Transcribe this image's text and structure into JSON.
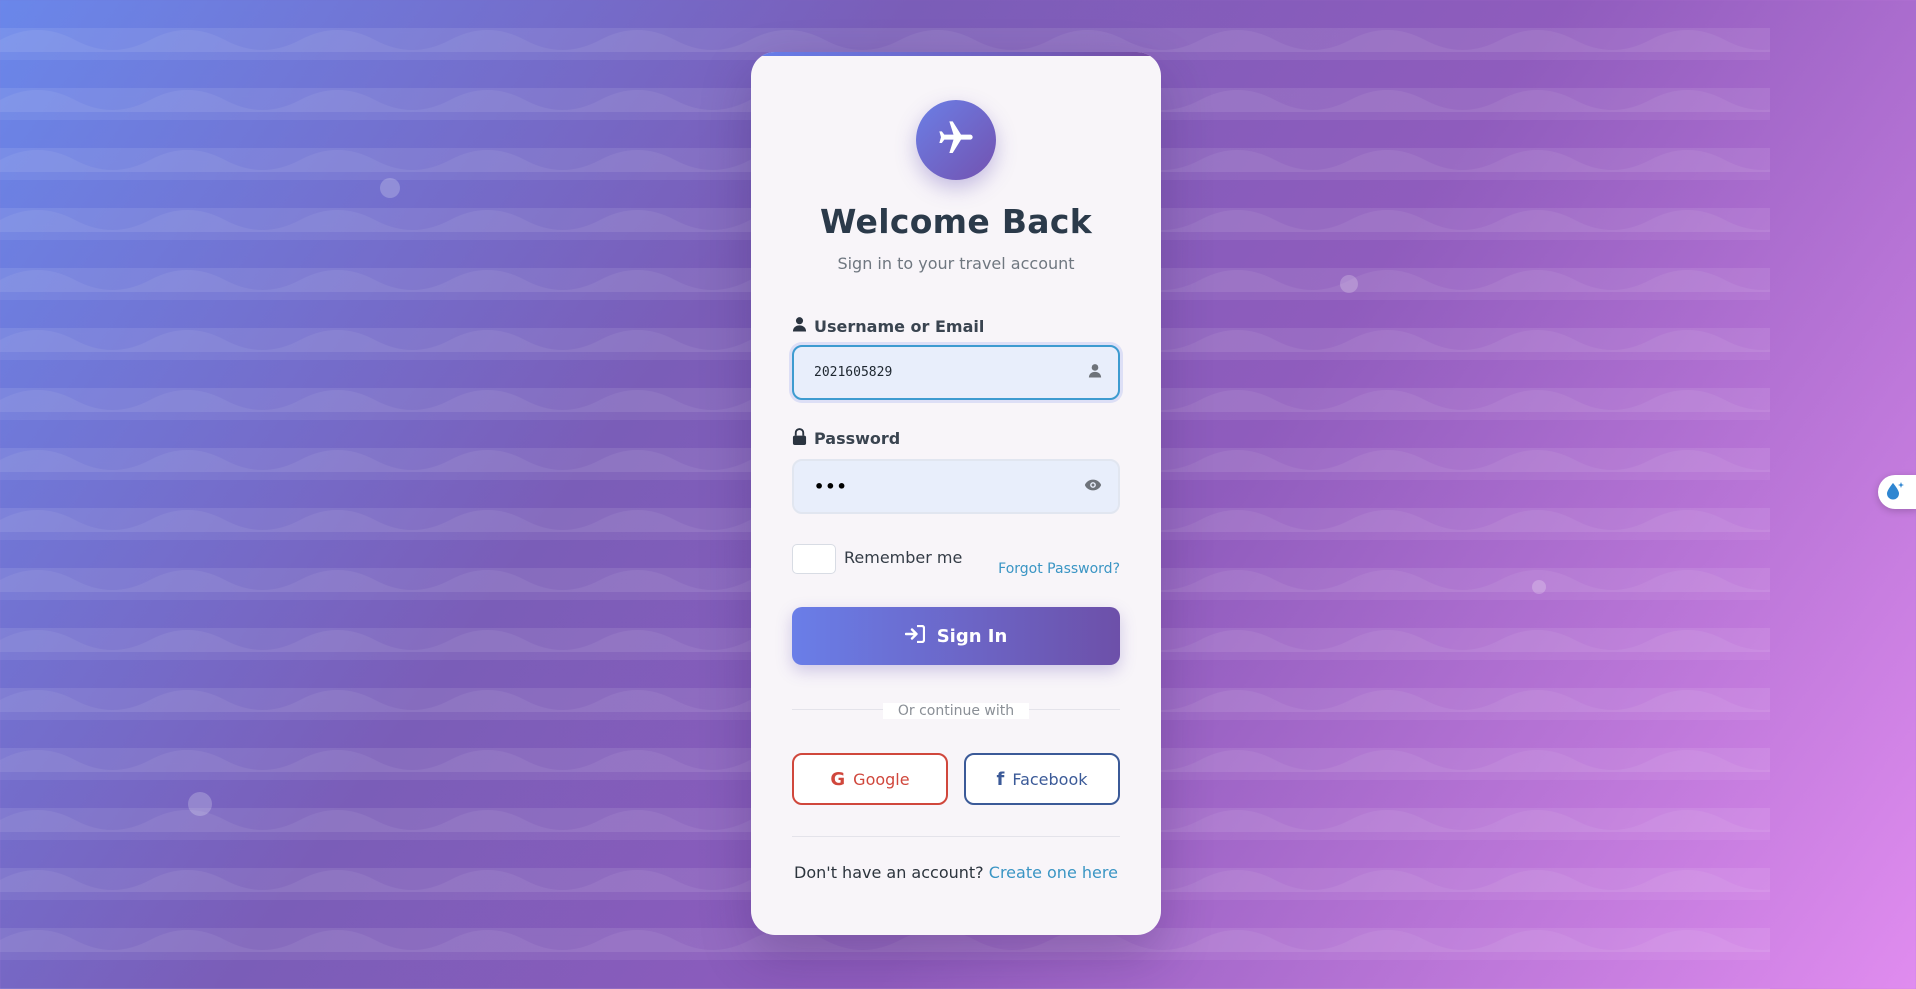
{
  "colors": {
    "accent_start": "#667eea",
    "accent_end": "#764ba2",
    "link": "#3a95c4",
    "google": "#d0473c",
    "facebook": "#3b5a98"
  },
  "header": {
    "logo_icon": "airplane-icon",
    "title": "Welcome Back",
    "subtitle": "Sign in to your travel account"
  },
  "form": {
    "username": {
      "label": "Username or Email",
      "label_icon": "user-icon",
      "value": "2021605829",
      "trailing_icon": "user-icon"
    },
    "password": {
      "label": "Password",
      "label_icon": "lock-icon",
      "value": "•••",
      "trailing_icon": "eye-icon"
    },
    "remember_label": "Remember me",
    "remember_checked": false,
    "forgot_link": "Forgot Password?",
    "submit_label": "Sign In",
    "submit_icon": "sign-in-icon"
  },
  "divider_text": "Or continue with",
  "social": {
    "google_label": "Google",
    "facebook_label": "Facebook"
  },
  "footer": {
    "prompt": "Don't have an account?",
    "link": "Create one here"
  },
  "side_widget_icon": "droplet-sparkle-icon"
}
